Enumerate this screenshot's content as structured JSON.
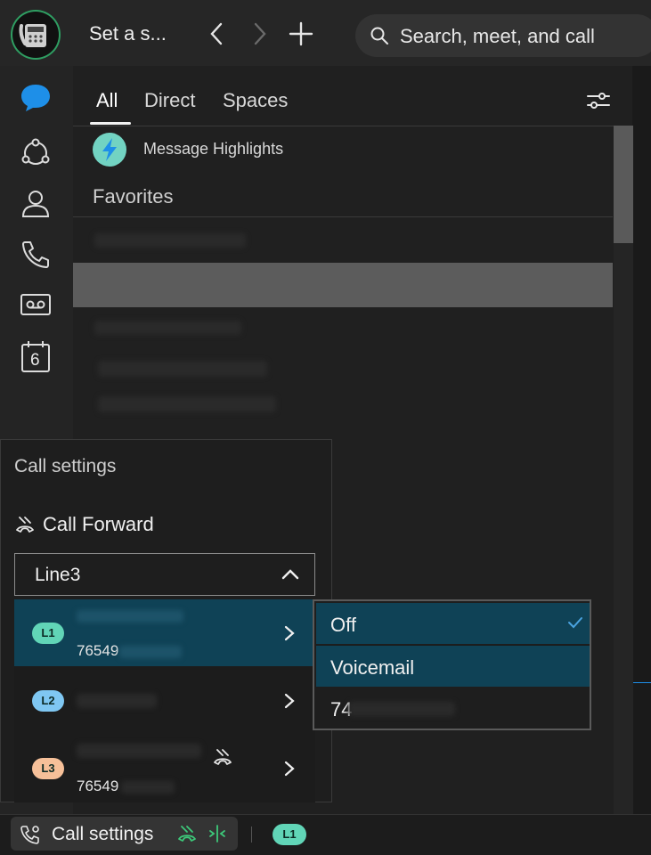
{
  "header": {
    "status_title": "Set a s...",
    "search_placeholder": "Search, meet, and call"
  },
  "tabs": [
    {
      "label": "All",
      "active": true
    },
    {
      "label": "Direct",
      "active": false
    },
    {
      "label": "Spaces",
      "active": false
    }
  ],
  "list": {
    "highlights_label": "Message Highlights",
    "favorites_label": "Favorites"
  },
  "rail": {
    "calendar_day": "6"
  },
  "call_settings": {
    "title": "Call settings",
    "forward_label": "Call Forward",
    "selected_line": "Line3",
    "lines": [
      {
        "badge": "L1",
        "number": "76549",
        "badge_color": "#61d5b7"
      },
      {
        "badge": "L2",
        "number": "",
        "badge_color": "#7fc7f2"
      },
      {
        "badge": "L3",
        "number": "76549",
        "badge_color": "#f6c099"
      }
    ],
    "forward_options": [
      {
        "label": "Off",
        "checked": true
      },
      {
        "label": "Voicemail",
        "checked": false
      },
      {
        "label": "74",
        "checked": false
      }
    ]
  },
  "statusbar": {
    "call_settings_label": "Call settings",
    "line_badge": "L1"
  },
  "colors": {
    "accent_blue": "#1e8fe8",
    "highlight_row": "#0f4256",
    "forward_green": "#3dc97a"
  }
}
